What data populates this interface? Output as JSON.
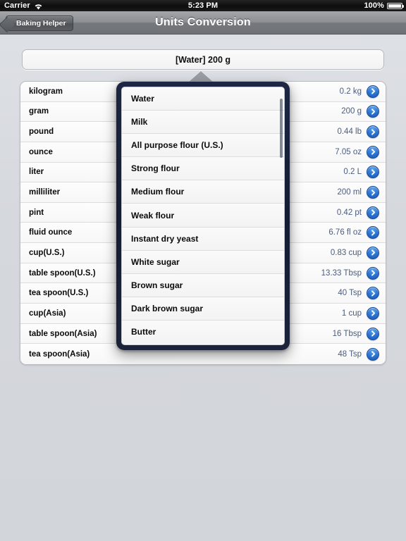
{
  "statusbar": {
    "carrier": "Carrier",
    "wifi_icon": "wifi-icon",
    "time": "5:23 PM",
    "battery_percent": "100%",
    "battery_icon": "battery-icon"
  },
  "navbar": {
    "back_label": "Baking Helper",
    "title": "Units Conversion"
  },
  "header": {
    "value": "[Water] 200 g"
  },
  "colors": {
    "accent_blue": "#2a72cf",
    "value_text": "#4a5c7e",
    "popover_border": "#141c33",
    "page_background": "#d7dade"
  },
  "table": {
    "rows": [
      {
        "unit": "kilogram",
        "value": "0.2 kg",
        "disclosure_icon": "chevron-right-icon"
      },
      {
        "unit": "gram",
        "value": "200 g",
        "disclosure_icon": "chevron-right-icon"
      },
      {
        "unit": "pound",
        "value": "0.44 lb",
        "disclosure_icon": "chevron-right-icon"
      },
      {
        "unit": "ounce",
        "value": "7.05 oz",
        "disclosure_icon": "chevron-right-icon"
      },
      {
        "unit": "liter",
        "value": "0.2 L",
        "disclosure_icon": "chevron-right-icon"
      },
      {
        "unit": "milliliter",
        "value": "200 ml",
        "disclosure_icon": "chevron-right-icon"
      },
      {
        "unit": "pint",
        "value": "0.42 pt",
        "disclosure_icon": "chevron-right-icon"
      },
      {
        "unit": "fluid ounce",
        "value": "6.76 fl oz",
        "disclosure_icon": "chevron-right-icon"
      },
      {
        "unit": "cup(U.S.)",
        "value": "0.83 cup",
        "disclosure_icon": "chevron-right-icon"
      },
      {
        "unit": "table spoon(U.S.)",
        "value": "13.33 Tbsp",
        "disclosure_icon": "chevron-right-icon"
      },
      {
        "unit": "tea spoon(U.S.)",
        "value": "40 Tsp",
        "disclosure_icon": "chevron-right-icon"
      },
      {
        "unit": "cup(Asia)",
        "value": "1 cup",
        "disclosure_icon": "chevron-right-icon"
      },
      {
        "unit": "table spoon(Asia)",
        "value": "16 Tbsp",
        "disclosure_icon": "chevron-right-icon"
      },
      {
        "unit": "tea spoon(Asia)",
        "value": "48 Tsp",
        "disclosure_icon": "chevron-right-icon"
      }
    ]
  },
  "popover": {
    "items": [
      {
        "label": "Water"
      },
      {
        "label": "Milk"
      },
      {
        "label": "All purpose flour (U.S.)"
      },
      {
        "label": "Strong flour"
      },
      {
        "label": "Medium flour"
      },
      {
        "label": "Weak flour"
      },
      {
        "label": "Instant dry yeast"
      },
      {
        "label": "White sugar"
      },
      {
        "label": "Brown sugar"
      },
      {
        "label": "Dark brown sugar"
      },
      {
        "label": "Butter"
      }
    ]
  }
}
